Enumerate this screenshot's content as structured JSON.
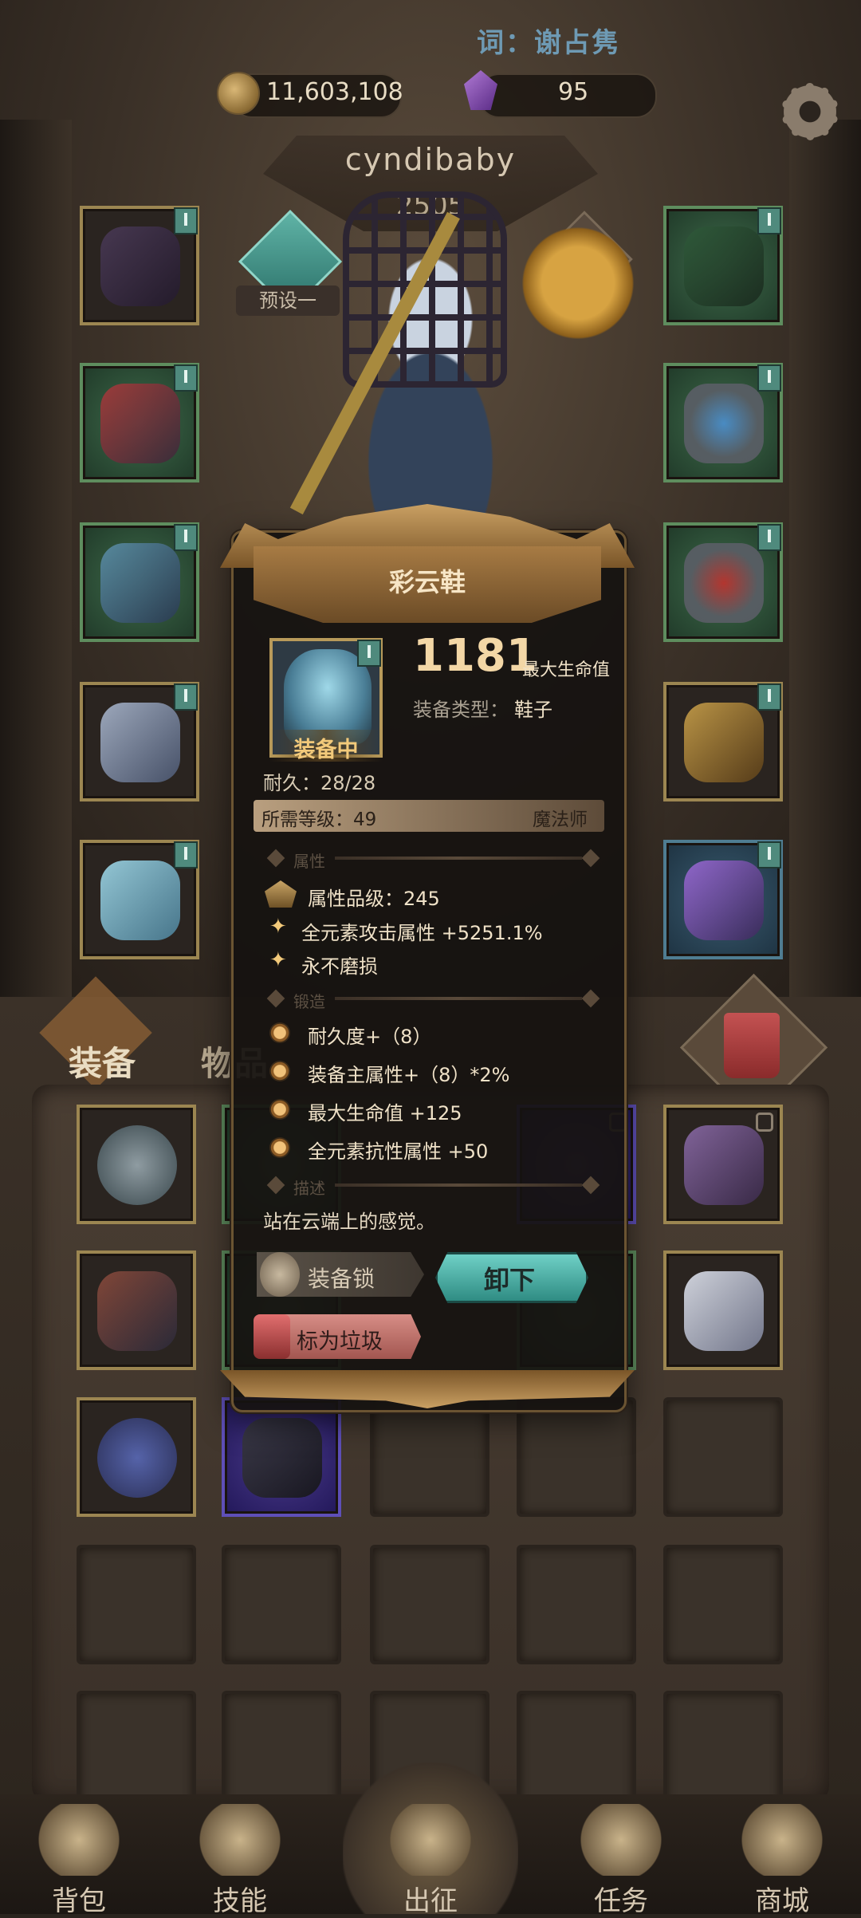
{
  "header": {
    "top_name": "词：谢占隽",
    "coins": "11,603,108",
    "gems": "95",
    "settings_icon": "gear-icon"
  },
  "player": {
    "name": "cyndibaby",
    "level": "2505",
    "preset": "预设一"
  },
  "equipment_slots": {
    "left": [
      "helmet-cage",
      "red-cloak-armor",
      "shard-gauntlet",
      "white-robe",
      "cloud-boots"
    ],
    "right": [
      "gem-necklace",
      "ring-blue",
      "ring-red",
      "golden-staff",
      "purple-shield"
    ]
  },
  "inventory": {
    "tabs": [
      "装备",
      "物品"
    ],
    "trash_icon": "trash-icon"
  },
  "tooltip": {
    "title": "彩云鞋",
    "equipped_label": "装备中",
    "main_value": "1181",
    "main_value_label": "最大生命值",
    "type_label": "装备类型：",
    "type_value": "鞋子",
    "durability": "耐久：28/28",
    "required_level": "所需等级：49",
    "class": "魔法师",
    "section_attr": "属性",
    "attr_rank": "属性品级：245",
    "attr_lines": [
      "全元素攻击属性 +5251.1%",
      "永不磨损"
    ],
    "section_forge": "锻造",
    "forge_lines": [
      "耐久度+（8）",
      "装备主属性+（8）*2%",
      "最大生命值 +125",
      "全元素抗性属性 +50"
    ],
    "section_desc": "描述",
    "description": "站在云端上的感觉。",
    "lock_button": "装备锁",
    "unequip_button": "卸下",
    "trash_button": "标为垃圾"
  },
  "nav": {
    "items": [
      "背包",
      "技能",
      "出征",
      "任务",
      "商城"
    ]
  },
  "colors": {
    "accent_gold": "#caa063",
    "teal_button": "#6fd0c6",
    "top_name": "#6e9ab4"
  }
}
